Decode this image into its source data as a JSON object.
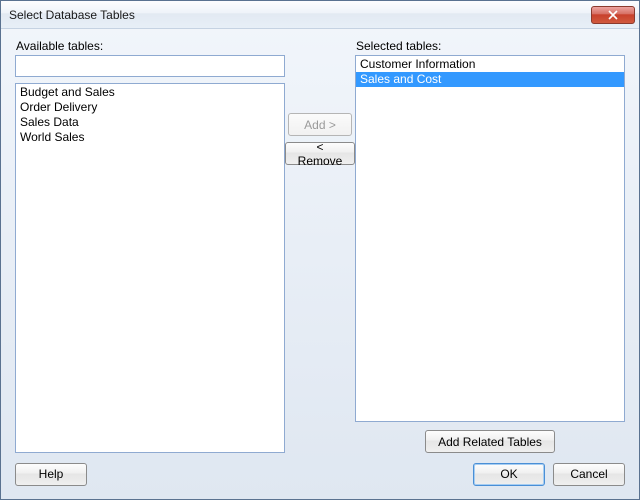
{
  "window": {
    "title": "Select Database Tables"
  },
  "labels": {
    "available": "Available tables:",
    "selected": "Selected tables:"
  },
  "filter": {
    "value": "",
    "placeholder": ""
  },
  "available_tables": [
    "Budget and Sales",
    "Order Delivery",
    "Sales Data",
    "World Sales"
  ],
  "selected_tables": [
    {
      "name": "Customer Information",
      "selected": false
    },
    {
      "name": "Sales and Cost",
      "selected": true
    }
  ],
  "buttons": {
    "add": "Add >",
    "remove": "< Remove",
    "add_related": "Add Related Tables",
    "help": "Help",
    "ok": "OK",
    "cancel": "Cancel"
  },
  "state": {
    "add_enabled": false,
    "remove_enabled": true
  }
}
